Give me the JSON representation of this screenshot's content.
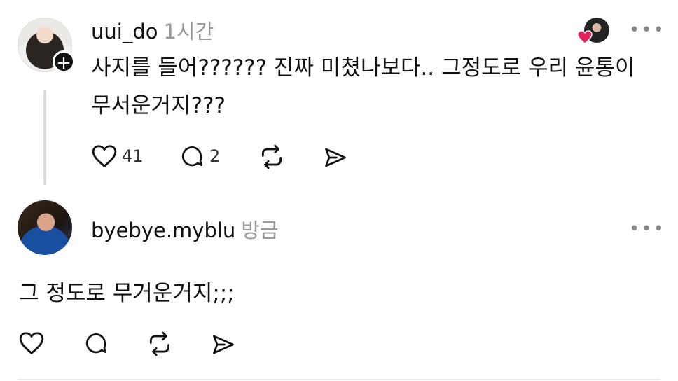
{
  "post1": {
    "username": "uui_do",
    "time": "1시간",
    "text_line1": "사지를 들어?????? 진짜 미쳤나보다.. 그정도로 우리 윤통이",
    "text_line2": "무서운거지???",
    "likes": "41",
    "replies": "2",
    "more": "•••"
  },
  "post2": {
    "username": "byebye.myblu",
    "time": "방금",
    "text": "그 정도로 무거운거지;;;",
    "more": "•••"
  },
  "colors": {
    "heart_badge": "#e0245e",
    "muted": "#9a9a9a",
    "thread_line": "#dcdcdc"
  },
  "icons": [
    "heart-icon",
    "reply-icon",
    "repost-icon",
    "share-icon",
    "more-icon",
    "plus-icon"
  ]
}
